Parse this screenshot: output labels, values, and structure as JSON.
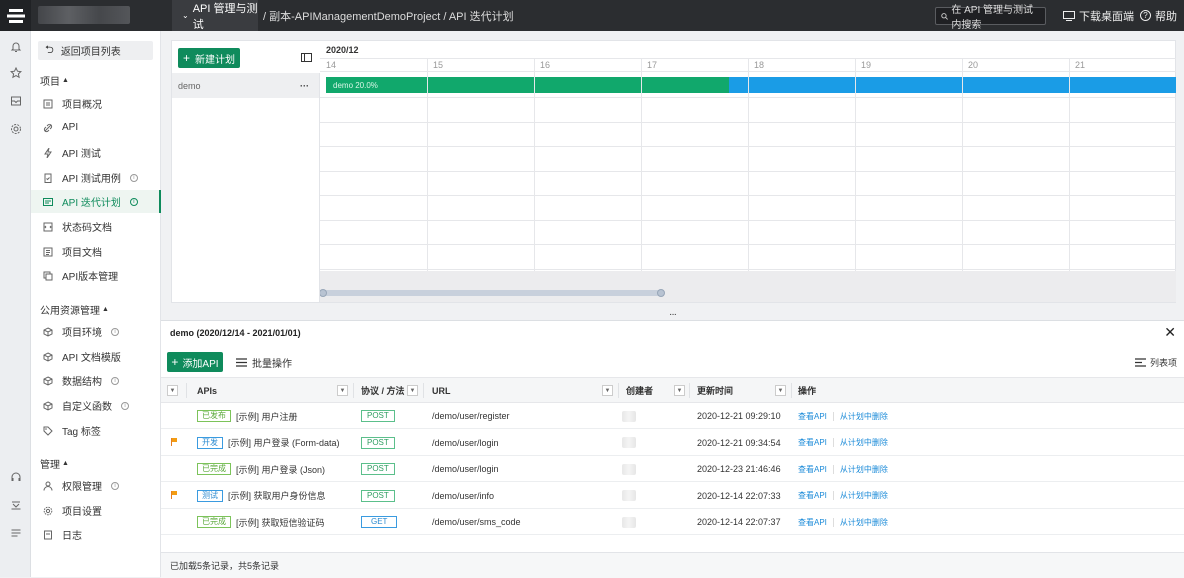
{
  "topbar": {
    "module_tab": "API 管理与测试",
    "breadcrumb": "/ 副本-APIManagementDemoProject / API 迭代计划",
    "search_placeholder": "在 API 管理与测试 内搜索",
    "download": "下载桌面端",
    "help": "帮助"
  },
  "rail_icons": [
    "bell-icon",
    "star-icon",
    "inbox-icon",
    "settings-icon",
    "headset-icon",
    "download-tray-icon",
    "list-icon"
  ],
  "nav": {
    "back": "返回项目列表",
    "sections": [
      {
        "title": "项目",
        "items": [
          {
            "label": "项目概况",
            "icon": "document-icon"
          },
          {
            "label": "API",
            "icon": "link-icon"
          },
          {
            "label": "API 测试",
            "icon": "bolt-icon"
          },
          {
            "label": "API 测试用例",
            "icon": "clipboard-icon",
            "info": true
          },
          {
            "label": "API 迭代计划",
            "icon": "calendar-icon",
            "info": true,
            "active": true
          },
          {
            "label": "状态码文档",
            "icon": "code-doc-icon"
          },
          {
            "label": "项目文档",
            "icon": "file-icon"
          },
          {
            "label": "API版本管理",
            "icon": "versions-icon"
          }
        ]
      },
      {
        "title": "公用资源管理",
        "items": [
          {
            "label": "项目环境",
            "icon": "cube-icon",
            "info": true
          },
          {
            "label": "API 文档模版",
            "icon": "cube-icon"
          },
          {
            "label": "数据结构",
            "icon": "cube-icon",
            "info": true
          },
          {
            "label": "自定义函数",
            "icon": "cube-icon",
            "info": true
          },
          {
            "label": "Tag 标签",
            "icon": "tag-icon"
          }
        ]
      },
      {
        "title": "管理",
        "items": [
          {
            "label": "权限管理",
            "icon": "user-icon",
            "info": true
          },
          {
            "label": "项目设置",
            "icon": "gear-icon"
          },
          {
            "label": "日志",
            "icon": "log-icon"
          }
        ]
      }
    ]
  },
  "plan": {
    "new_button": "新建计划",
    "plan_name": "demo",
    "more": "···",
    "month": "2020/12",
    "days": [
      "14",
      "15",
      "16",
      "17",
      "18",
      "19",
      "20",
      "21"
    ],
    "bar_label": "demo 20.0%",
    "progress": 0.2
  },
  "detail": {
    "title": "demo (2020/12/14 - 2021/01/01)",
    "close": "✕",
    "add_api": "添加API",
    "batch": "批量操作",
    "columns_button": "列表项",
    "headers": {
      "apis": "APIs",
      "method": "协议 / 方法",
      "url": "URL",
      "creator": "创建者",
      "updated": "更新时间",
      "actions": "操作"
    },
    "action_view": "查看API",
    "action_remove": "从计划中删除",
    "rows": [
      {
        "flag": false,
        "status": "已发布",
        "status_type": "ok",
        "name": "[示例] 用户注册",
        "method": "POST",
        "url": "/demo/user/register",
        "updated": "2020-12-21 09:29:10"
      },
      {
        "flag": true,
        "status": "开发",
        "status_type": "dev",
        "name": "[示例] 用户登录 (Form-data)",
        "method": "POST",
        "url": "/demo/user/login",
        "updated": "2020-12-21 09:34:54"
      },
      {
        "flag": false,
        "status": "已完成",
        "status_type": "ok",
        "name": "[示例] 用户登录 (Json)",
        "method": "POST",
        "url": "/demo/user/login",
        "updated": "2020-12-23 21:46:46"
      },
      {
        "flag": true,
        "status": "测试",
        "status_type": "dev",
        "name": "[示例] 获取用户身份信息",
        "method": "POST",
        "url": "/demo/user/info",
        "updated": "2020-12-14 22:07:33"
      },
      {
        "flag": false,
        "status": "已完成",
        "status_type": "ok",
        "name": "[示例] 获取短信验证码",
        "method": "GET",
        "url": "/demo/user/sms_code",
        "updated": "2020-12-14 22:07:37"
      }
    ],
    "footer": "已加载5条记录，共5条记录"
  }
}
